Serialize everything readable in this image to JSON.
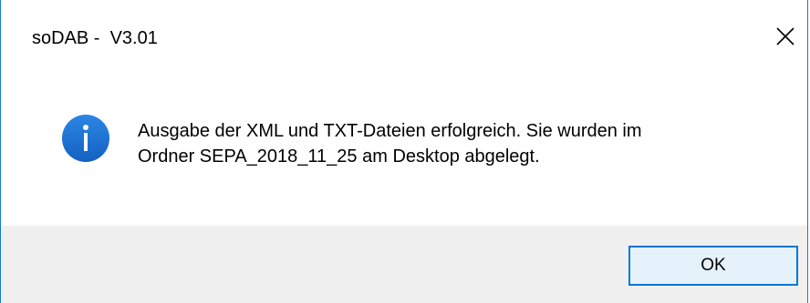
{
  "window": {
    "title": "soDAB -  V3.01",
    "close_icon": "close-icon"
  },
  "dialog": {
    "icon": "info-icon",
    "message_line1": "Ausgabe der XML und TXT-Dateien erfolgreich. Sie wurden im",
    "message_line2": "Ordner SEPA_2018_11_25 am Desktop abgelegt."
  },
  "buttons": {
    "ok_label": "OK"
  },
  "colors": {
    "accent": "#0078d7",
    "info_icon_fill": "#1a6fcf",
    "footer_bg": "#f0f0f0",
    "window_border": "#1979ca"
  }
}
